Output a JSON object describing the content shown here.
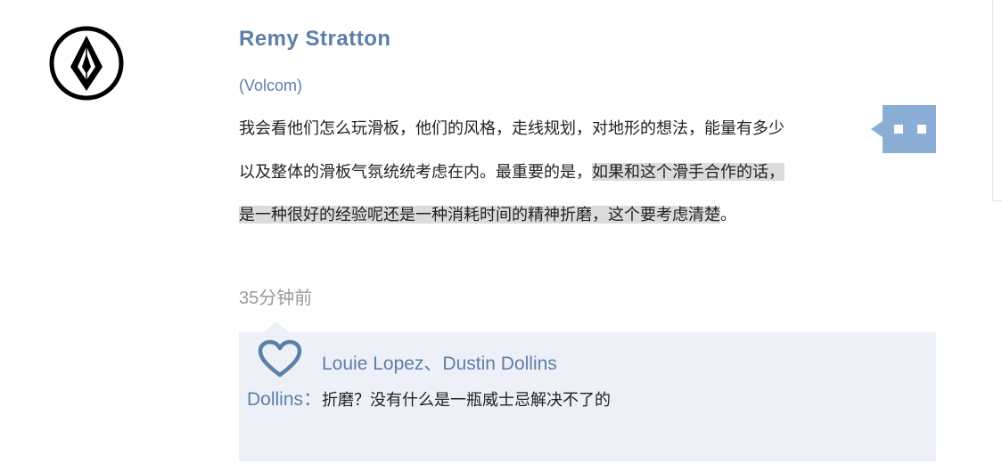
{
  "author": {
    "name": "Remy Stratton",
    "company": "(Volcom)"
  },
  "quote": {
    "line1": "我会看他们怎么玩滑板，他们的风格，走线规划，对地形的想法，能量有多少",
    "line2_plain": "以及整体的滑板气氛统统考虑在内。最重要的是，",
    "line2_highlight": "如果和这个滑手合作的话，",
    "line3_highlight": "是一种很好的经验呢还是一种消耗时间的精神折磨，这个要考虑清楚",
    "line3_tail": "。"
  },
  "timestamp": "35分钟前",
  "reply": {
    "likes": "Louie Lopez、Dustin Dollins",
    "comment_author": "Dollins：",
    "comment_text": "折磨？没有什么是一瓶威士忌解决不了的"
  },
  "icons": {
    "avatar": "volcom-stone-logo",
    "comment_tab": "comment-bubble-icon",
    "like": "heart-outline-icon"
  },
  "colors": {
    "accent": "#5b7fa8",
    "tab": "#8aaed6",
    "reply_bg": "#eef0f8",
    "highlight": "#dcdcdc"
  }
}
